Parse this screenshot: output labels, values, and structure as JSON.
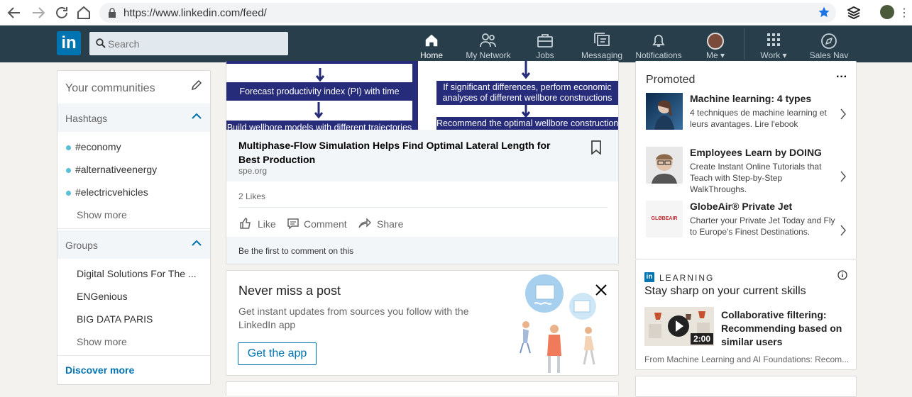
{
  "browser": {
    "url": "https://www.linkedin.com/feed/",
    "back_icon": "arrow-left-icon",
    "forward_icon": "arrow-right-icon",
    "reload_icon": "reload-icon",
    "home_icon": "home-icon",
    "secure_icon": "lock-icon",
    "star_icon": "star-icon"
  },
  "nav": {
    "logo": "in",
    "search_placeholder": "Search",
    "items": [
      {
        "label": "Home",
        "icon": "home-icon"
      },
      {
        "label": "My Network",
        "icon": "network-icon"
      },
      {
        "label": "Jobs",
        "icon": "briefcase-icon"
      },
      {
        "label": "Messaging",
        "icon": "messaging-icon"
      },
      {
        "label": "Notifications",
        "icon": "bell-icon"
      },
      {
        "label": "Me",
        "icon": "avatar"
      },
      {
        "label": "Work",
        "icon": "grid-icon"
      },
      {
        "label": "Sales Nav",
        "icon": "compass-icon"
      }
    ]
  },
  "left": {
    "communities_title": "Your communities",
    "hashtags_title": "Hashtags",
    "hashtags": [
      "#economy",
      "#alternativeenergy",
      "#electricvehicles"
    ],
    "show_more": "Show more",
    "groups_title": "Groups",
    "groups": [
      "Digital Solutions For The ...",
      "ENGenious",
      "BIG DATA PARIS"
    ],
    "discover_more": "Discover more"
  },
  "post": {
    "diagram_left_1": "Forecast productivity index (PI) with time",
    "diagram_left_2": "Build wellbore models with different trajectories",
    "diagram_right_1": "If significant differences, perform economic analyses of different wellbore constructions",
    "diagram_right_2": "Recommend the optimal wellbore construction",
    "title": "Multiphase-Flow Simulation Helps Find Optimal Lateral Length for Best Production",
    "source": "spe.org",
    "likes": "2 Likes",
    "like": "Like",
    "comment": "Comment",
    "share": "Share",
    "first_comment": "Be the first to comment on this"
  },
  "promo": {
    "title": "Never miss a post",
    "body": "Get instant updates from sources you follow with the LinkedIn app",
    "button": "Get the app"
  },
  "right": {
    "promoted": "Promoted",
    "ads": [
      {
        "title": "Machine learning: 4 types",
        "body": "4 techniques de machine learning et leurs avantages. Lire l'ebook"
      },
      {
        "title": "Employees Learn by DOING",
        "body": "Create Instant Online Tutorials that Teach with Step-by-Step WalkThroughs."
      },
      {
        "title": "GlobeAir® Private Jet",
        "body": "Charter your Private Jet Today and Fly to Europe's Finest Destinations.",
        "logo": "GLØBEAIR"
      }
    ],
    "learning_label": "LEARNING",
    "learning_sub": "Stay sharp on your current skills",
    "course_title": "Collaborative filtering: Recommending based on similar users",
    "course_duration": "2:00",
    "course_from": "From Machine Learning and AI Foundations: Recom..."
  },
  "colors": {
    "nav_bg": "#283e4a",
    "brand": "#0073b1",
    "diagram_box": "#262b7a",
    "hashtag_dot": "#5bbfd6"
  }
}
